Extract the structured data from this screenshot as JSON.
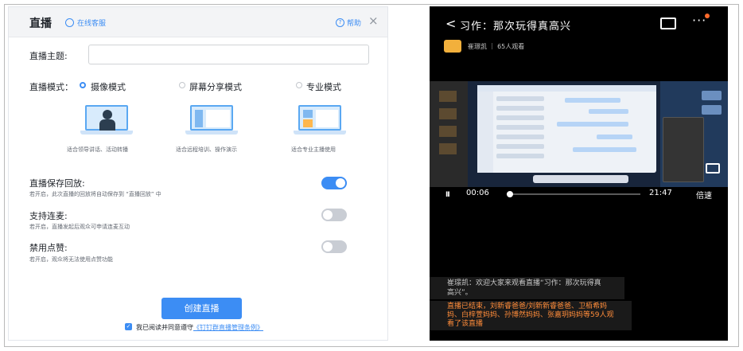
{
  "dialog": {
    "title": "直播",
    "service_label": "在线客服",
    "help_label": "帮助",
    "close_glyph": "×",
    "topic_label": "直播主题:",
    "topic_value": "",
    "mode_label": "直播模式：",
    "modes": [
      {
        "label": "摄像模式",
        "desc": "适合领导讲话、活动转播",
        "selected": true
      },
      {
        "label": "屏幕分享模式",
        "desc": "适合远程培训、操作演示",
        "selected": false
      },
      {
        "label": "专业模式",
        "desc": "适合专业主播使用",
        "selected": false
      }
    ],
    "settings": [
      {
        "title": "直播保存回放:",
        "desc": "若开启，此次直播的回放将自动保存到 “直播回放” 中",
        "on": true
      },
      {
        "title": "支持连麦:",
        "desc": "若开启，直播发起后观众可申请连麦互动",
        "on": false
      },
      {
        "title": "禁用点赞:",
        "desc": "若开启，观众将无法使用点赞功能",
        "on": false
      }
    ],
    "create_button": "创建直播",
    "agree_checked": true,
    "agree_text": "我已阅读并同意遵守",
    "agree_link": "《钉钉群直播管理条例》"
  },
  "phone": {
    "back_glyph": "<",
    "title": "习作：那次玩得真高兴",
    "more_glyph": "···",
    "host_line": "崔璟凯 ｜ 65人观看",
    "controls": {
      "play_glyph": "II",
      "current_time": "00:06",
      "total_time": "21:47",
      "progress": 0.005,
      "speed_label": "倍速"
    },
    "comments": [
      "崔璟凯：欢迎大家来观看直播“习作：那次玩得真高兴”。",
      "直播已结束，刘新睿爸爸/刘新新睿爸爸、卫栢希妈妈、白梓萱妈妈、孙博然妈妈、张嘉玥妈妈等59人观看了该直播"
    ]
  },
  "colors": {
    "accent": "#3c8df4",
    "toggle_off": "#c9cdd4",
    "phone_bg": "#000000",
    "highlight_comment": "#ff8c3a"
  }
}
